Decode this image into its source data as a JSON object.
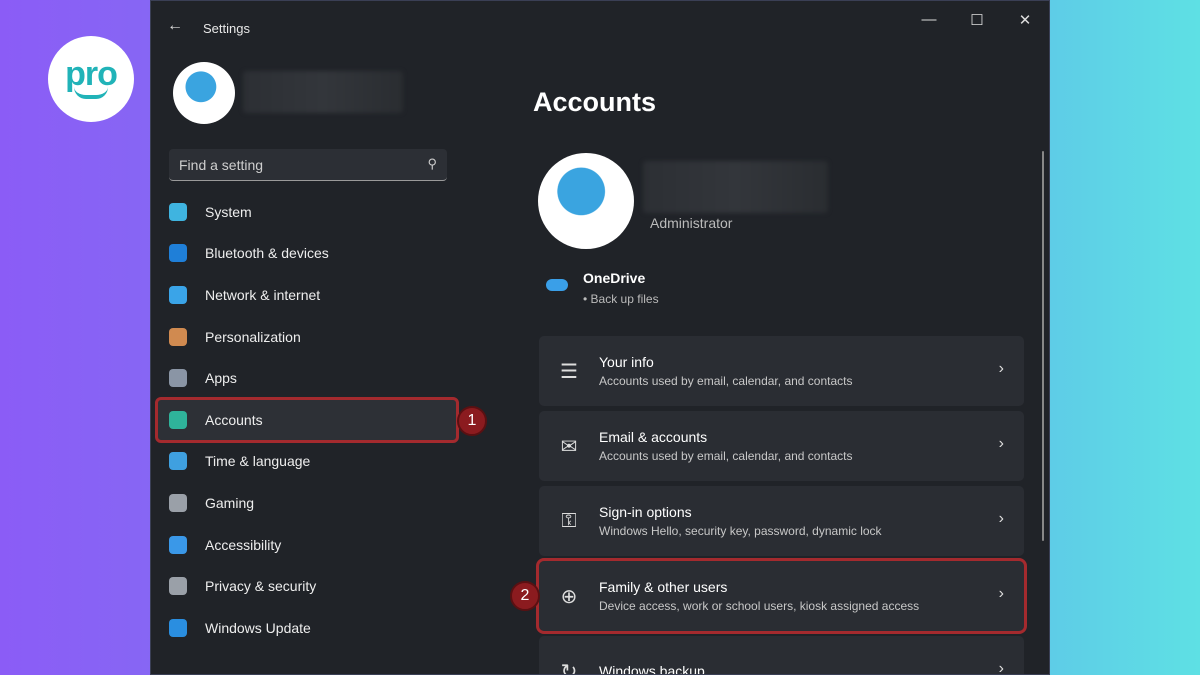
{
  "brand": {
    "logo_text": "pro"
  },
  "window": {
    "title": "Settings",
    "back_icon": "arrow-left-icon",
    "minimize": "—",
    "maximize": "☐",
    "close": "✕"
  },
  "sidebar": {
    "search_placeholder": "Find a setting",
    "items": [
      {
        "label": "System",
        "icon": "monitor-icon",
        "color": "#3fb4e0"
      },
      {
        "label": "Bluetooth & devices",
        "icon": "bluetooth-icon",
        "color": "#1f7fd8"
      },
      {
        "label": "Network & internet",
        "icon": "wifi-icon",
        "color": "#3aa4e8"
      },
      {
        "label": "Personalization",
        "icon": "brush-icon",
        "color": "#d08a50"
      },
      {
        "label": "Apps",
        "icon": "apps-icon",
        "color": "#8a95a5"
      },
      {
        "label": "Accounts",
        "icon": "person-icon",
        "color": "#2fb39a",
        "selected": true
      },
      {
        "label": "Time & language",
        "icon": "clock-globe-icon",
        "color": "#3fa0e0"
      },
      {
        "label": "Gaming",
        "icon": "gamepad-icon",
        "color": "#9aa0a8"
      },
      {
        "label": "Accessibility",
        "icon": "accessibility-icon",
        "color": "#3a98e8"
      },
      {
        "label": "Privacy & security",
        "icon": "shield-icon",
        "color": "#9aa0a8"
      },
      {
        "label": "Windows Update",
        "icon": "refresh-icon",
        "color": "#2a8ee0"
      }
    ]
  },
  "annotations": {
    "step1": "1",
    "step2": "2",
    "highlight_color": "#a42a2e"
  },
  "main": {
    "title": "Accounts",
    "role": "Administrator",
    "onedrive": {
      "title": "OneDrive",
      "subtitle": "• Back up files"
    },
    "cards": [
      {
        "title": "Your info",
        "subtitle": "Accounts used by email, calendar, and contacts",
        "icon": "person-list-icon",
        "glyph": "☰"
      },
      {
        "title": "Email & accounts",
        "subtitle": "Accounts used by email, calendar, and contacts",
        "icon": "mail-icon",
        "glyph": "✉"
      },
      {
        "title": "Sign-in options",
        "subtitle": "Windows Hello, security key, password, dynamic lock",
        "icon": "key-icon",
        "glyph": "⚿"
      },
      {
        "title": "Family & other users",
        "subtitle": "Device access, work or school users, kiosk assigned access",
        "icon": "person-add-icon",
        "glyph": "⊕",
        "highlighted": true
      },
      {
        "title": "Windows backup",
        "subtitle": "",
        "icon": "backup-icon",
        "glyph": "↻"
      }
    ]
  }
}
